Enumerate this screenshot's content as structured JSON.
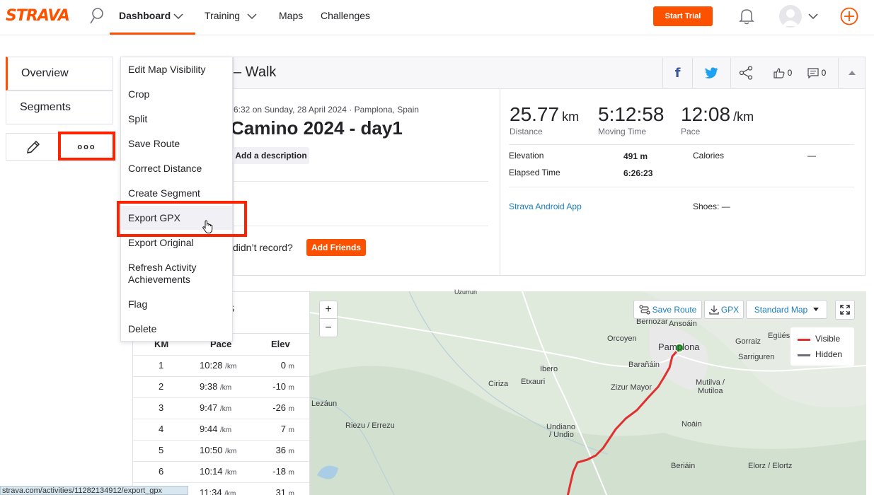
{
  "brand": {
    "logo": "STRAVA",
    "accent": "#fc5200"
  },
  "nav": {
    "dashboard": "Dashboard",
    "training": "Training",
    "maps": "Maps",
    "challenges": "Challenges",
    "start_trial": "Start Trial"
  },
  "sidebar": {
    "overview": "Overview",
    "segments": "Segments",
    "more": "ooo"
  },
  "menu": {
    "items": [
      "Edit Map Visibility",
      "Crop",
      "Split",
      "Save Route",
      "Correct Distance",
      "Create Segment",
      "Export GPX",
      "Export Original",
      "Refresh Activity Achievements",
      "Flag",
      "Delete"
    ]
  },
  "activity": {
    "title": "– Walk",
    "date": "6:32 on Sunday, 28 April 2024 · Pamplona, Spain",
    "name": "Camino 2024 - day1",
    "add_description": "Add a description",
    "friends_question": "didn’t record?",
    "add_friends": "Add Friends",
    "kudos_count": "0",
    "comments_count": "0"
  },
  "stats": {
    "distance": {
      "value": "25.77",
      "unit": "km",
      "label": "Distance"
    },
    "moving_time": {
      "value": "5:12:58",
      "label": "Moving Time"
    },
    "pace": {
      "value": "12:08",
      "unit": "/km",
      "label": "Pace"
    },
    "elevation_label": "Elevation",
    "elevation_value": "491 m",
    "elapsed_label": "Elapsed Time",
    "elapsed_value": "6:26:23",
    "calories_label": "Calories",
    "calories_value": "—",
    "device": "Strava Android App",
    "shoes": "Shoes: —"
  },
  "splits": {
    "title": "s",
    "headers": {
      "km": "KM",
      "pace": "Pace",
      "elev": "Elev"
    },
    "pace_unit": "/km",
    "elev_unit": "m",
    "rows": [
      {
        "km": "1",
        "pace": "10:28",
        "elev": "0"
      },
      {
        "km": "2",
        "pace": "9:38",
        "elev": "-10"
      },
      {
        "km": "3",
        "pace": "9:47",
        "elev": "-26"
      },
      {
        "km": "4",
        "pace": "9:44",
        "elev": "7"
      },
      {
        "km": "5",
        "pace": "10:50",
        "elev": "36"
      },
      {
        "km": "6",
        "pace": "10:14",
        "elev": "-18"
      },
      {
        "km": "",
        "pace": "11:34",
        "elev": "31"
      }
    ]
  },
  "map": {
    "save_route": "Save Route",
    "gpx": "GPX",
    "map_type": "Standard Map",
    "zoom_in": "+",
    "zoom_out": "−",
    "legend_visible": "Visible",
    "legend_hidden": "Hidden",
    "places": {
      "uzurrun": "Uzurrun",
      "berriozar": "Berriozar",
      "ansoain": "Ansoáin",
      "egues": "Egüés",
      "orcoyen": "Orcoyen",
      "pamplona": "Pamplona",
      "gorraiz": "Gorraiz",
      "baranain": "Barañáin",
      "sarriguren": "Sarriguren",
      "ibero": "Ibero",
      "ciriza": "Ciriza",
      "etxauri": "Etxauri",
      "zizur": "Zizur Mayor",
      "mutilva": "Mutilva /",
      "mutiloa": "Mutiloa",
      "lezaun": "Lezáun",
      "riezu": "Riezu / Errezu",
      "noain": "Noáin",
      "undiano": "Undiano",
      "undio": "/ Undio",
      "beriain": "Beriáin",
      "elorz": "Elorz / Elortz"
    }
  },
  "status_url": "strava.com/activities/11282134912/export_gpx"
}
